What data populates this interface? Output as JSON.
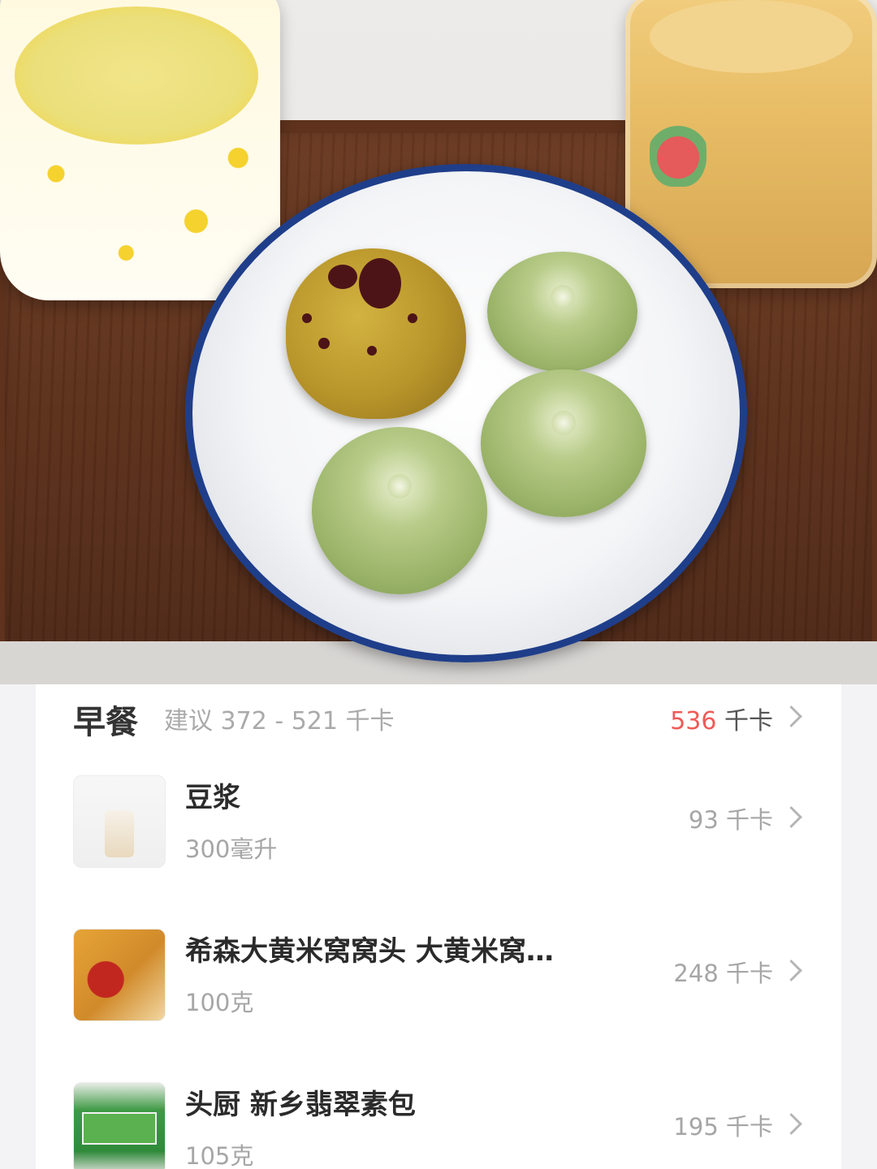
{
  "meal": {
    "title": "早餐",
    "suggest": "建议 372 - 521 千卡",
    "total_value": "536",
    "total_unit": " 千卡",
    "accent_color": "#ee5b57"
  },
  "items": [
    {
      "name": "豆浆",
      "amount": "300毫升",
      "kcal": "93 千卡"
    },
    {
      "name": "希森大黄米窝窝头 大黄米窝…",
      "amount": "100克",
      "kcal": "248 千卡"
    },
    {
      "name": "头厨 新乡翡翠素包",
      "amount": "105克",
      "kcal": "195 千卡"
    }
  ]
}
